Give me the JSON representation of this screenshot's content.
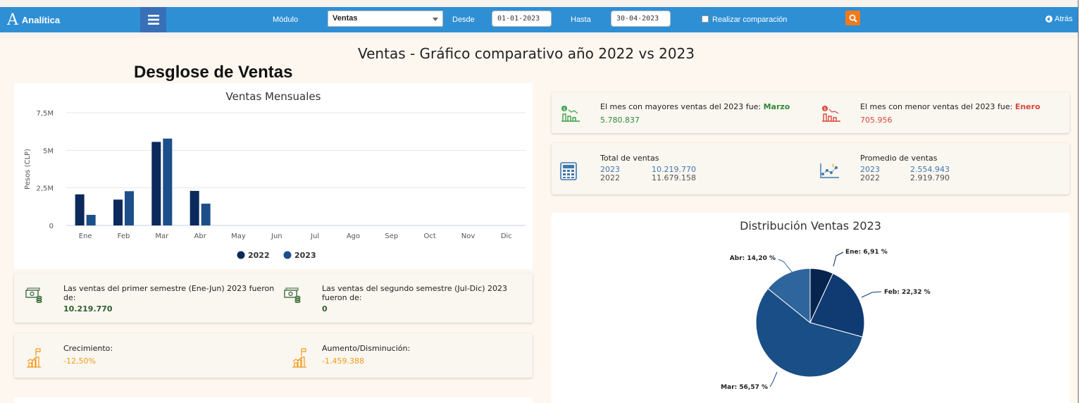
{
  "header": {
    "logo_letter": "A",
    "app_name": "Analítica",
    "modulo_label": "Módulo",
    "modulo_value": "Ventas",
    "desde_label": "Desde",
    "desde_value": "01-01-2023",
    "hasta_label": "Hasta",
    "hasta_value": "30-04-2023",
    "comparar_label": "Realizar comparación",
    "back_label": "Atrás"
  },
  "page_title": "Ventas - Gráfico comparativo año 2022 vs 2023",
  "section_title": "Desglose de Ventas",
  "stats": {
    "max_label": "El mes con mayores ventas del 2023 fue:",
    "max_month": "Marzo",
    "max_value": "5.780.837",
    "min_label": "El mes con menor ventas del 2023 fue:",
    "min_month": "Enero",
    "min_value": "705.956",
    "total_label": "Total de ventas",
    "total_2023_year": "2023",
    "total_2023_value": "10.219.770",
    "total_2022_year": "2022",
    "total_2022_value": "11.679.158",
    "avg_label": "Promedio de ventas",
    "avg_2023_year": "2023",
    "avg_2023_value": "2.554.943",
    "avg_2022_year": "2022",
    "avg_2022_value": "2.919.790",
    "sem1_label": "Las ventas del primer semestre (Ene-Jun) 2023 fueron de:",
    "sem1_value": "10.219.770",
    "sem2_label": "Las ventas del segundo semestre (Jul-Dic) 2023 fueron de:",
    "sem2_value": "0",
    "growth_label": "Crecimiento:",
    "growth_value": "-12,50%",
    "change_label": "Aumento/Disminución:",
    "change_value": "-1.459.388"
  },
  "colors": {
    "navbar": "#2e8fd4",
    "series_2022": "#0b2a5b",
    "series_2023": "#1c4f8a",
    "positive": "#2f8a3a",
    "negative": "#d9473b",
    "accent": "#f29a1a"
  },
  "icons": {
    "menu": "hamburger-icon",
    "search": "search-icon",
    "back": "arrow-left-circle-icon",
    "max": "chart-up-money-icon",
    "min": "chart-down-money-icon",
    "total": "calculator-icon",
    "avg": "scatter-chart-icon",
    "semester": "money-stack-icon",
    "growth": "growth-flag-icon"
  },
  "chart_data": [
    {
      "type": "bar",
      "title": "Ventas Mensuales",
      "ylabel": "Pesos (CLP)",
      "xlabel": "",
      "categories": [
        "Ene",
        "Feb",
        "Mar",
        "Abr",
        "May",
        "Jun",
        "Jul",
        "Ago",
        "Sep",
        "Oct",
        "Nov",
        "Dic"
      ],
      "series": [
        {
          "name": "2022",
          "values": [
            2070000,
            1720000,
            5560000,
            2300000,
            null,
            null,
            null,
            null,
            null,
            null,
            null,
            null
          ]
        },
        {
          "name": "2023",
          "values": [
            705956,
            2280000,
            5780837,
            1450000,
            null,
            null,
            null,
            null,
            null,
            null,
            null,
            null
          ]
        }
      ],
      "yticks": [
        "0",
        "2,5M",
        "5M",
        "7,5M"
      ],
      "ytick_values": [
        0,
        2500000,
        5000000,
        7500000
      ],
      "ylim": [
        0,
        7500000
      ],
      "grid": true,
      "legend": "bottom-center"
    },
    {
      "type": "pie",
      "title": "Distribución Ventas 2023",
      "slices": [
        {
          "label": "Ene",
          "value": 6.91,
          "text": "Ene: 6,91 %",
          "color": "#07244e"
        },
        {
          "label": "Feb",
          "value": 22.32,
          "text": "Feb: 22,32 %",
          "color": "#0f3a72"
        },
        {
          "label": "Mar",
          "value": 56.57,
          "text": "Mar: 56,57 %",
          "color": "#1a4e86"
        },
        {
          "label": "Abr",
          "value": 14.2,
          "text": "Abr: 14,20 %",
          "color": "#2f659d"
        }
      ]
    }
  ]
}
